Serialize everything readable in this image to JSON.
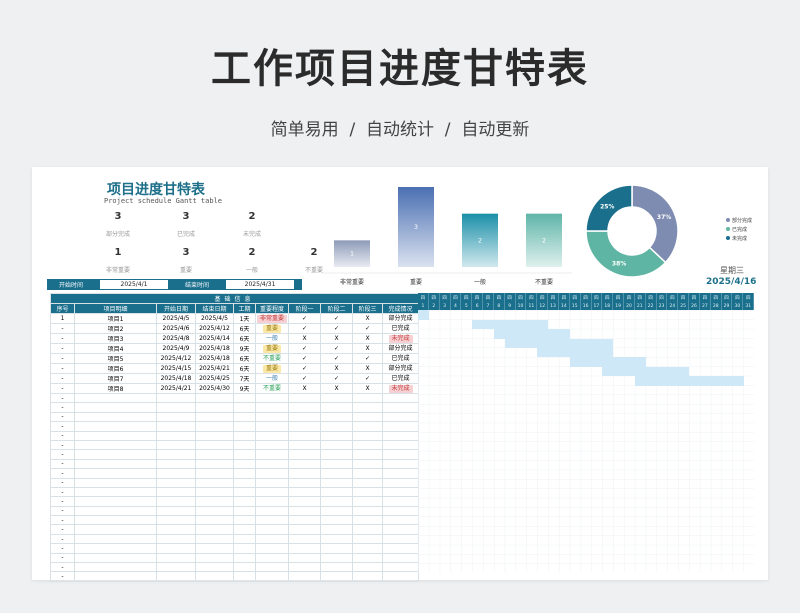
{
  "page_title": "工作项目进度甘特表",
  "page_subtitle": "简单易用  /  自动统计  /  自动更新",
  "doc_title": "项目进度甘特表",
  "doc_subtitle": "Project schedule Gantt table",
  "stats": [
    {
      "n": "3",
      "label": "部分完成"
    },
    {
      "n": "3",
      "label": "已完成"
    },
    {
      "n": "2",
      "label": "未完成"
    },
    {
      "n": "1",
      "label": "非常重要"
    },
    {
      "n": "3",
      "label": "重要"
    },
    {
      "n": "2",
      "label": "一般"
    },
    {
      "n": "2",
      "label": "不重要"
    }
  ],
  "chart_data": [
    {
      "type": "bar",
      "categories": [
        "非常重要",
        "重要",
        "一般",
        "不重要"
      ],
      "values": [
        1,
        3,
        2,
        2
      ],
      "ylim": [
        0,
        3
      ],
      "colors": [
        "#8d9bb8",
        "#4a6fb2",
        "#1b8fa8",
        "#5fb5a8"
      ]
    },
    {
      "type": "pie",
      "labels": [
        "部分完成",
        "已完成",
        "未完成"
      ],
      "values": [
        37,
        38,
        25
      ],
      "data_labels": [
        "37%",
        "38%",
        "25%"
      ],
      "colors": [
        "#7d8cb0",
        "#5fb5a3",
        "#1a6f8c"
      ],
      "legend": "right"
    }
  ],
  "weekday": "星期三",
  "today": "2025/4/16",
  "start_label": "开始时间",
  "start_value": "2025/4/1",
  "end_label": "结束时间",
  "end_value": "2025/4/31",
  "group_header": "基础信息",
  "columns": [
    "序号",
    "项目明细",
    "开始日期",
    "结束日期",
    "工期",
    "重要程度",
    "阶段一",
    "阶段二",
    "阶段三",
    "完成情况"
  ],
  "rows": [
    {
      "seq": "1",
      "name": "项目1",
      "start": "2025/4/5",
      "end": "2025/4/5",
      "dur": "1天",
      "imp": "非常重要",
      "imp_c": "t-vimp",
      "p1": "✓",
      "p2": "✓",
      "p3": "X",
      "status": "部分完成",
      "s_c": ""
    },
    {
      "seq": "-",
      "name": "项目2",
      "start": "2025/4/6",
      "end": "2025/4/12",
      "dur": "6天",
      "imp": "重要",
      "imp_c": "t-imp",
      "p1": "✓",
      "p2": "✓",
      "p3": "✓",
      "status": "已完成",
      "s_c": ""
    },
    {
      "seq": "-",
      "name": "项目3",
      "start": "2025/4/8",
      "end": "2025/4/14",
      "dur": "6天",
      "imp": "一般",
      "imp_c": "t-gen",
      "p1": "X",
      "p2": "X",
      "p3": "X",
      "status": "未完成",
      "s_c": "s-todo"
    },
    {
      "seq": "-",
      "name": "项目4",
      "start": "2025/4/9",
      "end": "2025/4/18",
      "dur": "9天",
      "imp": "重要",
      "imp_c": "t-imp",
      "p1": "✓",
      "p2": "✓",
      "p3": "X",
      "status": "部分完成",
      "s_c": ""
    },
    {
      "seq": "-",
      "name": "项目5",
      "start": "2025/4/12",
      "end": "2025/4/18",
      "dur": "6天",
      "imp": "不重要",
      "imp_c": "t-not",
      "p1": "✓",
      "p2": "✓",
      "p3": "✓",
      "status": "已完成",
      "s_c": ""
    },
    {
      "seq": "-",
      "name": "项目6",
      "start": "2025/4/15",
      "end": "2025/4/21",
      "dur": "6天",
      "imp": "重要",
      "imp_c": "t-imp",
      "p1": "✓",
      "p2": "X",
      "p3": "X",
      "status": "部分完成",
      "s_c": ""
    },
    {
      "seq": "-",
      "name": "项目7",
      "start": "2025/4/18",
      "end": "2025/4/25",
      "dur": "7天",
      "imp": "一般",
      "imp_c": "t-gen",
      "p1": "✓",
      "p2": "✓",
      "p3": "✓",
      "status": "已完成",
      "s_c": ""
    },
    {
      "seq": "-",
      "name": "项目8",
      "start": "2025/4/21",
      "end": "2025/4/30",
      "dur": "9天",
      "imp": "不重要",
      "imp_c": "t-not",
      "p1": "X",
      "p2": "X",
      "p3": "X",
      "status": "未完成",
      "s_c": "s-todo"
    }
  ],
  "empty_rows": 20,
  "gantt_days": 31,
  "gantt_tasks": [
    [
      1,
      1
    ],
    [
      6,
      12
    ],
    [
      8,
      14
    ],
    [
      9,
      18
    ],
    [
      12,
      18
    ],
    [
      15,
      21
    ],
    [
      18,
      25
    ],
    [
      21,
      30
    ]
  ],
  "gantt_color": "#cfe8f7"
}
